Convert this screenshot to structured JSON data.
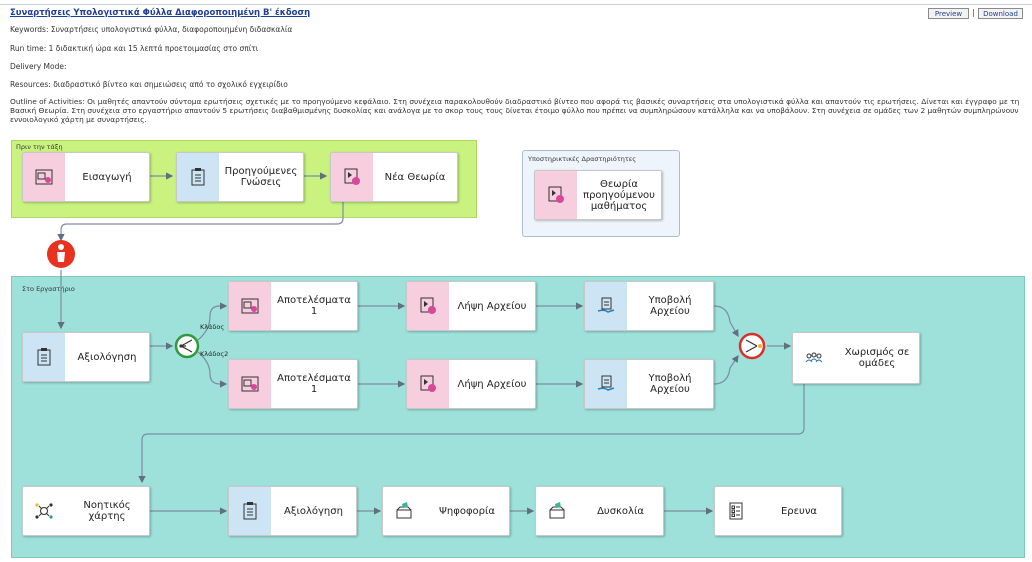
{
  "header": {
    "title": "Συναρτήσεις Υπολογιστικά Φύλλα Διαφοροποιημένη Β' έκδοση",
    "preview_label": "Preview",
    "separator": "|",
    "download_label": "Download"
  },
  "meta": {
    "keywords": "Keywords: Συναρτήσεις υπολογιστικά φύλλα, διαφοροποιημένη διδασκαλία",
    "runtime": "Run time: 1 διδακτική ώρα και 15 λεπτά προετοιμασίας στο σπίτι",
    "delivery": "Delivery Mode:",
    "resources": "Resources: διαδραστικό βίντεο και σημειώσεις από το σχολικό εγχειρίδιο",
    "outline": "Outline of Activities: Οι μαθητές απαντούν σύντομα ερωτήσεις σχετικές με το προηγούμενο κεφάλαιο. Στη συνέχεια παρακολουθούν διαδραστικό βίντεο που αφορά τις βασικές συναρτήσεις στα υπολογιστικά φύλλα και απαντούν τις ερωτήσεις. Δίνεται και έγγραφο με τη Βασική Θεωρία. Στη συνέχεια στο εργαστήριο απαντούν 5 ερωτήσεις διαβαθμισμένης δυσκολίας και ανάλογα με το σκορ τους τους δίνεται έτοιμο φύλλο που πρέπει να συμπληρώσουν κατάλληλα και να υποβάλουν. Στη συνέχεια σε ομάδες των 2 μαθητών συμπληρώνουν εννοιολογικό χάρτη με συναρτήσεις."
  },
  "groups": {
    "before_class": "Πριν την τάξη",
    "support": "Υποστηρικτικές Δραστηριότητες",
    "lab": "Στο Εργαστήριο"
  },
  "cards": {
    "intro": "Εισαγωγή",
    "prior_knowledge": "Προηγούμενες Γνώσεις",
    "new_theory": "Νέα Θεωρία",
    "prev_theory": "Θεωρία προηγούμενου μαθήματος",
    "assessment1": "Αξιολόγηση",
    "results1": "Αποτελέσματα 1",
    "get_file1": "Λήψη Αρχείου",
    "submit_file1": "Υποβολή Αρχείου",
    "results2": "Αποτελέσματα 1",
    "get_file2": "Λήψη Αρχείου",
    "submit_file2": "Υποβολή Αρχείου",
    "grouping": "Χωρισμός σε ομάδες",
    "concept_map": "Νοητικός χάρτης",
    "assessment2": "Αξιολόγηση",
    "vote": "Ψηφοφορία",
    "difficulty": "Δυσκολία",
    "survey": "Ερευνα"
  },
  "branches": {
    "branch1": "Κλάδος",
    "branch2": "Κλάδος2"
  },
  "colors": {
    "before_group": "#c9f27f",
    "lab_group": "#9ee1da",
    "support_group": "#eef4fb",
    "video_icon_bg": "#f7cede",
    "doc_icon_bg": "#cde4f4",
    "teacher_marker": "#e8311f",
    "branch_gate": "#2e9a3a",
    "merge_gate": "#d9302a"
  },
  "icons": {
    "video": "video-card-icon",
    "doc": "clipboard-icon",
    "upload": "upload-hand-icon",
    "group": "group-users-icon",
    "map": "concept-map-icon",
    "vote": "ballot-box-icon",
    "survey": "checklist-icon",
    "teacher": "person-marker-icon"
  }
}
